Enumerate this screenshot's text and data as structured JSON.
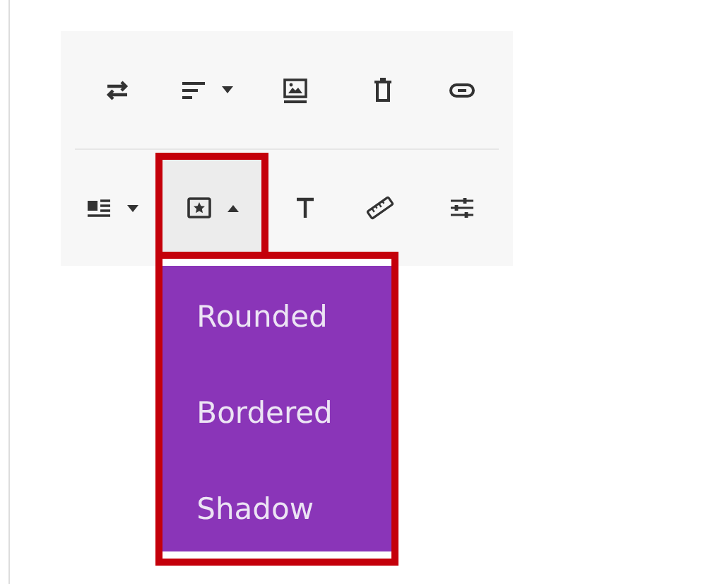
{
  "toolbar": {
    "rows": [
      {
        "buttons": [
          {
            "kind": "swap",
            "dropdown": false,
            "expanded": false,
            "highlighted": false
          },
          {
            "kind": "align",
            "dropdown": true,
            "expanded": false,
            "highlighted": false
          },
          {
            "kind": "image",
            "dropdown": false,
            "expanded": false,
            "highlighted": false
          },
          {
            "kind": "delete",
            "dropdown": false,
            "expanded": false,
            "highlighted": false
          },
          {
            "kind": "link",
            "dropdown": false,
            "expanded": false,
            "highlighted": false
          }
        ]
      },
      {
        "buttons": [
          {
            "kind": "wrap",
            "dropdown": true,
            "expanded": false,
            "highlighted": false
          },
          {
            "kind": "style",
            "dropdown": true,
            "expanded": true,
            "highlighted": true
          },
          {
            "kind": "text",
            "dropdown": false,
            "expanded": false,
            "highlighted": false
          },
          {
            "kind": "measure",
            "dropdown": false,
            "expanded": false,
            "highlighted": false
          },
          {
            "kind": "settings",
            "dropdown": false,
            "expanded": false,
            "highlighted": false
          }
        ]
      }
    ]
  },
  "dropdown_menu": {
    "highlighted": true,
    "items": [
      {
        "label": "Rounded"
      },
      {
        "label": "Bordered"
      },
      {
        "label": "Shadow"
      }
    ]
  }
}
